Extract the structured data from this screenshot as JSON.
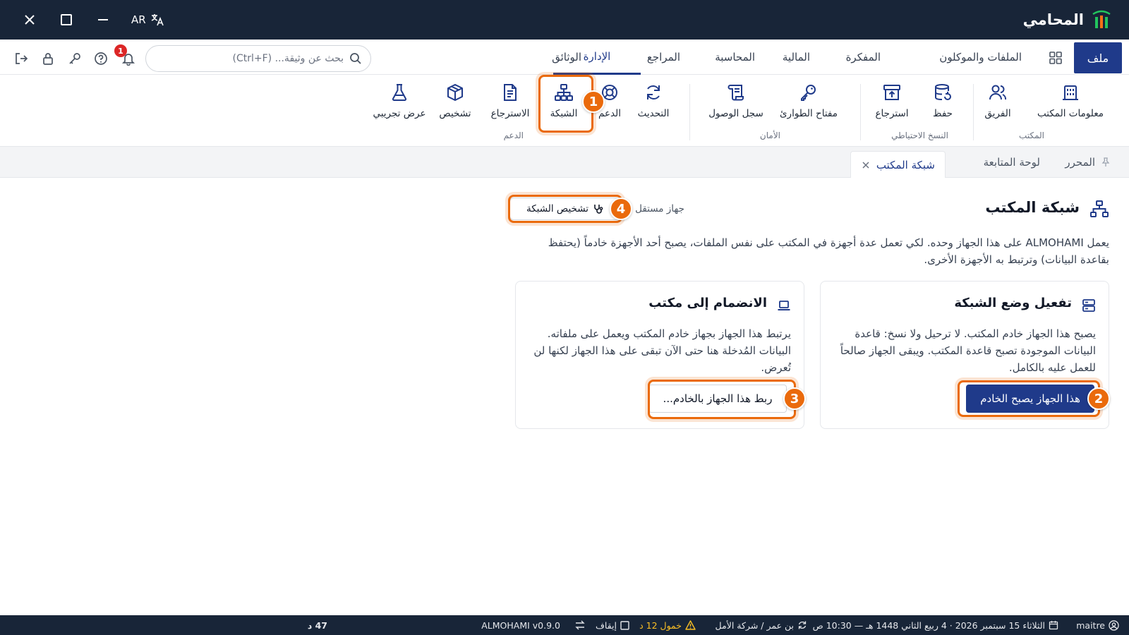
{
  "app": {
    "name": "المحامي",
    "lang": "AR"
  },
  "menu": {
    "file": "ملف",
    "tabs": [
      "الملفات والموكلون",
      "المفكرة",
      "المالية",
      "المحاسبة",
      "المراجع",
      "الإدارة",
      "الوثائق"
    ],
    "active_tab": "الإدارة"
  },
  "search": {
    "placeholder": "بحث عن وثيقة... (Ctrl+F)"
  },
  "notifications": {
    "count": "1"
  },
  "ribbon": {
    "groups": {
      "office": "المكتب",
      "backup": "النسخ الاحتياطي",
      "security": "الأمان",
      "support": "الدعم"
    },
    "items": {
      "office_info": "معلومات المكتب",
      "team": "الفريق",
      "save": "حفظ",
      "restore": "استرجاع",
      "emergency_key": "مفتاح الطوارئ",
      "access_log": "سجل الوصول",
      "update": "التحديث",
      "support": "الدعم",
      "network": "الشبكة",
      "recovery": "الاسترجاع",
      "diagnosis": "تشخيص",
      "demo": "عرض تجريبي"
    }
  },
  "doc_tabs": {
    "editor": "المحرر",
    "dashboard": "لوحة المتابعة",
    "network": "شبكة المكتب"
  },
  "page": {
    "title": "شبكة المكتب",
    "device_mode": "جهاز مستقل",
    "diagnose_button": "تشخيص الشبكة",
    "intro": "يعمل ALMOHAMI على هذا الجهاز وحده. لكي تعمل عدة أجهزة في المكتب على نفس الملفات، يصبح أحد الأجهزة خادماً (يحتفظ بقاعدة البيانات) وترتبط به الأجهزة الأخرى."
  },
  "cards": {
    "server": {
      "title": "تفعيل وضع الشبكة",
      "description": "يصبح هذا الجهاز خادم المكتب. لا ترحيل ولا نسخ: قاعدة البيانات الموجودة تصبح قاعدة المكتب. ويبقى الجهاز صالحاً للعمل عليه بالكامل.",
      "button": "هذا الجهاز يصبح الخادم"
    },
    "join": {
      "title": "الانضمام إلى مكتب",
      "description": "يرتبط هذا الجهاز بجهاز خادم المكتب ويعمل على ملفاته. البيانات المُدخلة هنا حتى الآن تبقى على هذا الجهاز لكنها لن تُعرض.",
      "button": "ربط هذا الجهاز بالخادم..."
    }
  },
  "callouts": [
    "1",
    "2",
    "3",
    "4"
  ],
  "statusbar": {
    "user": "maitre",
    "date": "الثلاثاء 15 سبتمبر 2026 · 4 ربيع الثاني 1448 هـ — 10:30 ص",
    "sync_minutes": "47 د",
    "office": "بن عمر / شركة الأمل",
    "idle": "خمول 12 د",
    "stop": "إيقاف",
    "version": "ALMOHAMI v0.9.0"
  },
  "colors": {
    "navy": "#182538",
    "accent": "#1f3a8a",
    "highlight": "#ea6a0c"
  }
}
